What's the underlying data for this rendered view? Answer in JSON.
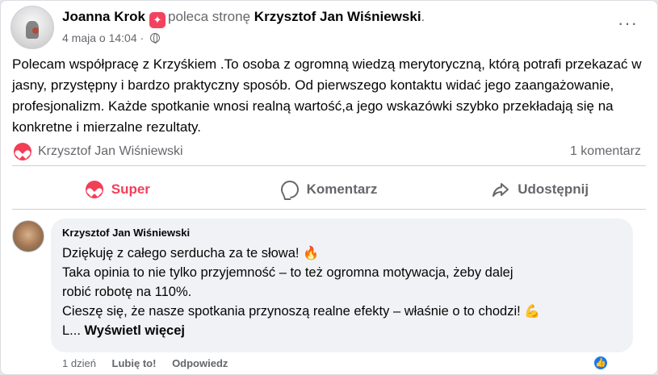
{
  "post": {
    "author": "Joanna Krok",
    "recommends_text": "poleca stronę",
    "page_name": "Krzysztof Jan Wiśniewski",
    "period": ".",
    "date": "4 maja o 14:04",
    "dot": "·",
    "more": "···",
    "body": "Polecam współpracę z Krzyśkiem .To osoba z ogromną wiedzą merytoryczną, którą potrafi przekazać w jasny, przystępny i bardzo praktyczny sposób. Od pierwszego kontaktu widać jego zaangażowanie, profesjonalizm. Każde spotkanie wnosi realną wartość,a jego wskazówki szybko przekładają się na konkretne i mierzalne rezultaty."
  },
  "reactions": {
    "names": "Krzysztof Jan Wiśniewski",
    "comments_count": "1 komentarz"
  },
  "actions": {
    "like": "Super",
    "comment": "Komentarz",
    "share": "Udostępnij"
  },
  "comment": {
    "author": "Krzysztof Jan Wiśniewski",
    "line1": "Dziękuję z całego serducha za te słowa!",
    "line2": "Taka opinia to nie tylko przyjemność – to też ogromna motywacja, żeby dalej",
    "line3": "robić robotę na 110%.",
    "line4": "Cieszę się, że nasze spotkania przynoszą realne efekty – właśnie o to chodzi!",
    "line5_prefix": "L...",
    "see_more": "Wyświetl więcej",
    "emoji1": "🔥",
    "emoji2": "💪",
    "time": "1 dzień",
    "like_label": "Lubię to!",
    "reply_label": "Odpowiedz",
    "like_badge": "👍"
  },
  "colors": {
    "love_red": "#f33e58",
    "like_blue": "#1877f2",
    "muted_text": "#65676b",
    "bubble_bg": "#f0f2f5"
  }
}
